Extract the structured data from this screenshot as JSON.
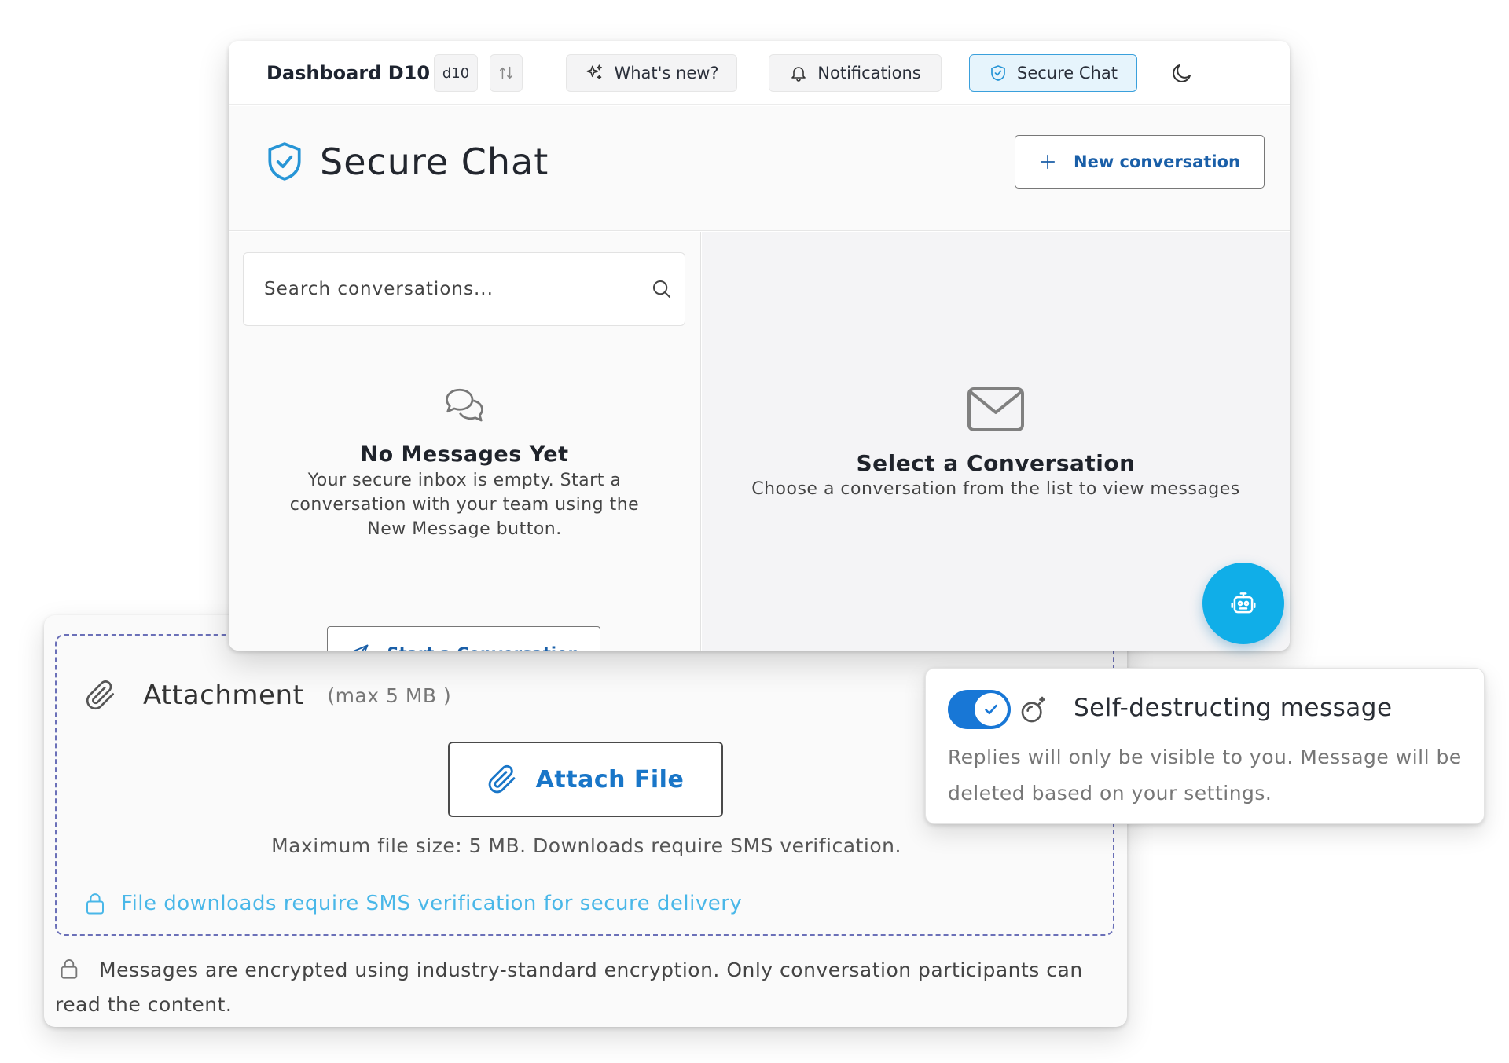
{
  "topbar": {
    "brand": "Dashboard D10",
    "version_chip": "d10",
    "whats_new": "What's new?",
    "notifications": "Notifications",
    "secure_chat": "Secure Chat"
  },
  "page": {
    "title": "Secure Chat",
    "new_conversation": "New conversation"
  },
  "search": {
    "placeholder": "Search conversations..."
  },
  "empty_list": {
    "title": "No Messages Yet",
    "description": "Your secure inbox is empty. Start a conversation with your team using the New Message button.",
    "button": "Start a Conversation"
  },
  "empty_detail": {
    "title": "Select a Conversation",
    "description": "Choose a conversation from the list to view messages"
  },
  "attachment": {
    "title": "Attachment",
    "max": "(max 5 MB )",
    "button": "Attach File",
    "note": "Maximum file size: 5 MB. Downloads require SMS verification.",
    "sms_note": "File downloads require SMS verification for secure delivery"
  },
  "encryption_note": "Messages are encrypted using industry-standard encryption. Only conversation participants can read the content.",
  "self_destruct": {
    "title": "Self-destructing message",
    "description": "Replies will only be visible to you. Message will be deleted based on your settings.",
    "enabled": true
  },
  "colors": {
    "accent": "#2795d6",
    "link": "#1a5fa8",
    "fab": "#10aee8",
    "toggle": "#1877d6",
    "sms_text": "#49b7e8",
    "dashed_border": "#6b70b8"
  },
  "icons": {
    "whats_new": "sparkles-icon",
    "notifications": "bell-icon",
    "secure_chat": "shield-check-icon",
    "theme": "moon-icon",
    "swap": "swap-icon",
    "search": "search-icon",
    "empty_list": "chat-bubbles-icon",
    "empty_detail": "mail-icon",
    "start": "send-icon",
    "fab": "robot-icon",
    "attachment": "paperclip-icon",
    "lock": "lock-icon",
    "self_destruct": "bomb-icon"
  }
}
